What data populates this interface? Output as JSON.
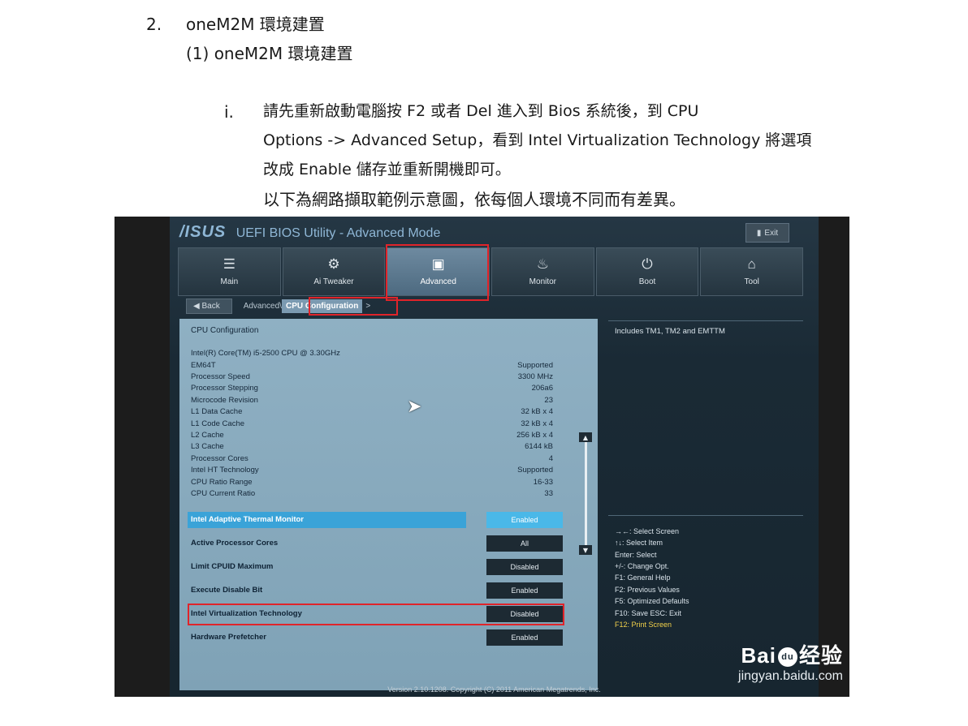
{
  "document": {
    "heading_number": "2.",
    "heading_text": "oneM2M  環境建置",
    "subheading": "(1) oneM2M  環境建置",
    "step_number": "i.",
    "paragraph_lines": [
      "請先重新啟動電腦按 F2 或者 Del 進入到 Bios 系統後，到 CPU",
      "Options -> Advanced Setup，看到 Intel Virtualization Technology 將選項",
      "改成 Enable 儲存並重新開機即可。",
      "以下為網路擷取範例示意圖，依每個人環境不同而有差異。"
    ]
  },
  "bios": {
    "logo": "/ISUS",
    "title": "UEFI BIOS Utility - Advanced Mode",
    "exit_label": "Exit",
    "tabs": [
      {
        "label": "Main",
        "icon": "list-icon"
      },
      {
        "label": "Ai Tweaker",
        "icon": "tweaker-icon"
      },
      {
        "label": "Advanced",
        "icon": "advanced-icon"
      },
      {
        "label": "Monitor",
        "icon": "monitor-icon"
      },
      {
        "label": "Boot",
        "icon": "power-icon"
      },
      {
        "label": "Tool",
        "icon": "tool-icon"
      }
    ],
    "breadcrumb": {
      "back": "Back",
      "parent": "Advanced\\",
      "current": "CPU Configuration",
      "arrow": ">"
    },
    "panel_heading": "CPU Configuration",
    "cpu_name": "Intel(R) Core(TM) i5-2500 CPU @ 3.30GHz",
    "specs": [
      {
        "label": "EM64T",
        "value": "Supported"
      },
      {
        "label": "Processor Speed",
        "value": "3300 MHz"
      },
      {
        "label": "Processor Stepping",
        "value": "206a6"
      },
      {
        "label": "Microcode Revision",
        "value": "23"
      },
      {
        "label": "L1 Data Cache",
        "value": "32 kB x 4"
      },
      {
        "label": "L1 Code Cache",
        "value": "32 kB x 4"
      },
      {
        "label": "L2 Cache",
        "value": "256 kB x 4"
      },
      {
        "label": "L3 Cache",
        "value": "6144 kB"
      },
      {
        "label": "Processor Cores",
        "value": "4"
      },
      {
        "label": "Intel HT Technology",
        "value": "Supported"
      },
      {
        "label": "CPU Ratio Range",
        "value": "16-33"
      },
      {
        "label": "CPU Current Ratio",
        "value": "33"
      }
    ],
    "options": [
      {
        "label": "Intel Adaptive Thermal Monitor",
        "value": "Enabled",
        "highlighted": true
      },
      {
        "label": "Active Processor Cores",
        "value": "All"
      },
      {
        "label": "Limit CPUID Maximum",
        "value": "Disabled"
      },
      {
        "label": "Execute Disable Bit",
        "value": "Enabled"
      },
      {
        "label": "Intel Virtualization Technology",
        "value": "Disabled",
        "boxed": true
      },
      {
        "label": "Hardware Prefetcher",
        "value": "Enabled"
      }
    ],
    "help_text": "Includes TM1, TM2 and EMTTM",
    "key_help": [
      "→←: Select Screen",
      "↑↓: Select Item",
      "Enter: Select",
      "+/-: Change Opt.",
      "F1: General Help",
      "F2: Previous Values",
      "F5: Optimized Defaults",
      "F10: Save   ESC: Exit",
      "F12: Print Screen"
    ],
    "footer": "Version 2.10.1208. Copyright (C) 2011 American Megatrends, Inc.",
    "watermark": {
      "brand": "Bai",
      "paw": "du",
      "cn": "经验",
      "url": "jingyan.baidu.com"
    },
    "colors": {
      "highlight": "#3aa3d8",
      "annotation_red": "#e0242a",
      "panel": "#8fb0c3"
    }
  }
}
